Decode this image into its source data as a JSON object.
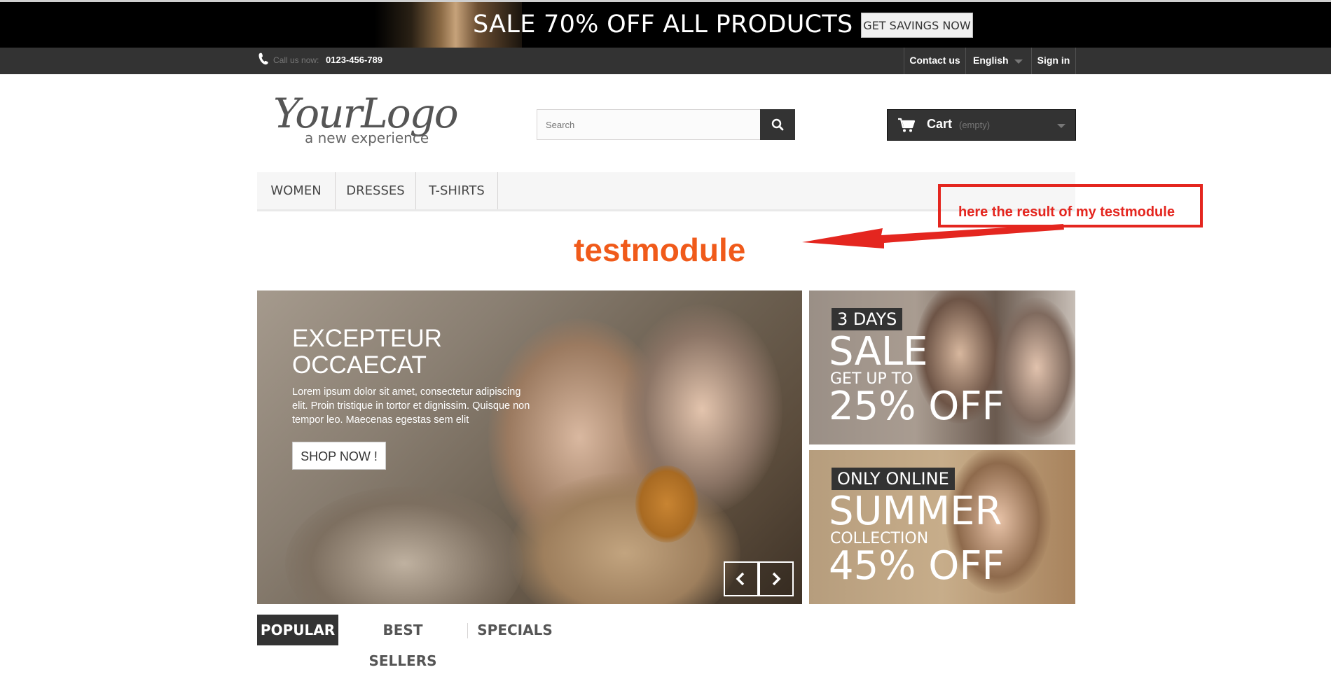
{
  "promo": {
    "title": "SALE 70% OFF ALL PRODUCTS",
    "button_label": "GET SAVINGS NOW"
  },
  "topnav": {
    "call_label": "Call us now:",
    "phone": "0123-456-789",
    "contact_label": "Contact us",
    "language_label": "English",
    "signin_label": "Sign in"
  },
  "header": {
    "logo_text": "YourLogo",
    "logo_tagline": "a new experience",
    "search_placeholder": "Search",
    "cart_label": "Cart",
    "cart_status": "(empty)"
  },
  "menu": {
    "items": [
      "WOMEN",
      "DRESSES",
      "T-SHIRTS"
    ]
  },
  "annotation": {
    "note": "here the result of my testmodule",
    "module_output": "testmodule",
    "accent_color": "#e4261f"
  },
  "slider": {
    "title_line1": "EXCEPTEUR",
    "title_line2": "OCCAECAT",
    "text": "Lorem ipsum dolor sit amet, consectetur adipiscing elit. Proin tristique in tortor et dignissim. Quisque non tempor leo. Maecenas egestas sem elit",
    "button_label": "SHOP NOW !"
  },
  "banners": [
    {
      "tag": "3 DAYS",
      "headline": "SALE",
      "subline": "GET UP TO",
      "offer": "25% OFF"
    },
    {
      "tag": "ONLY ONLINE",
      "headline": "SUMMER",
      "subline": "COLLECTION",
      "offer": "45% OFF"
    }
  ],
  "tabs": {
    "items": [
      "POPULAR",
      "BEST SELLERS",
      "SPECIALS"
    ],
    "active": "POPULAR"
  }
}
